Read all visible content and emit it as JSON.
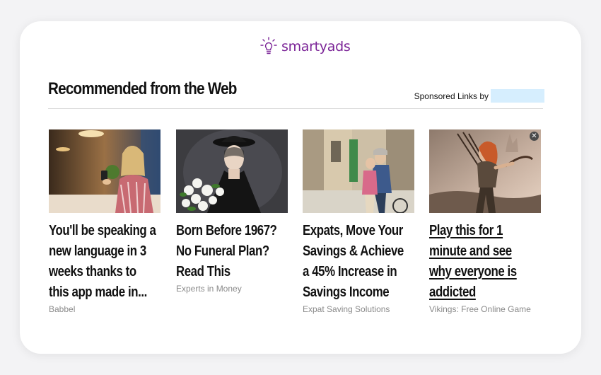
{
  "brand": {
    "name": "smartyads",
    "icon": "lightbulb-icon",
    "color": "#7b2497"
  },
  "widget": {
    "heading": "Recommended from the Web",
    "sponsored_label": "Sponsored Links by"
  },
  "items": [
    {
      "title": "You'll be speaking a\nnew language in 3\nweeks thanks to\nthis app made in...",
      "source": "Babbel",
      "image": "woman-with-phone-photo"
    },
    {
      "title": "Born Before 1967?\nNo Funeral Plan?\nRead This",
      "source": "Experts in Money",
      "image": "woman-with-flowers-photo"
    },
    {
      "title": "Expats, Move Your\nSavings & Achieve\na 45% Increase in\nSavings Income",
      "source": "Expat Saving Solutions",
      "image": "couple-on-street-photo"
    },
    {
      "title": "Play this for 1\nminute and see\nwhy everyone is\naddicted",
      "source": "Vikings: Free Online Game",
      "image": "archer-game-art",
      "close_icon": "close-icon"
    }
  ]
}
